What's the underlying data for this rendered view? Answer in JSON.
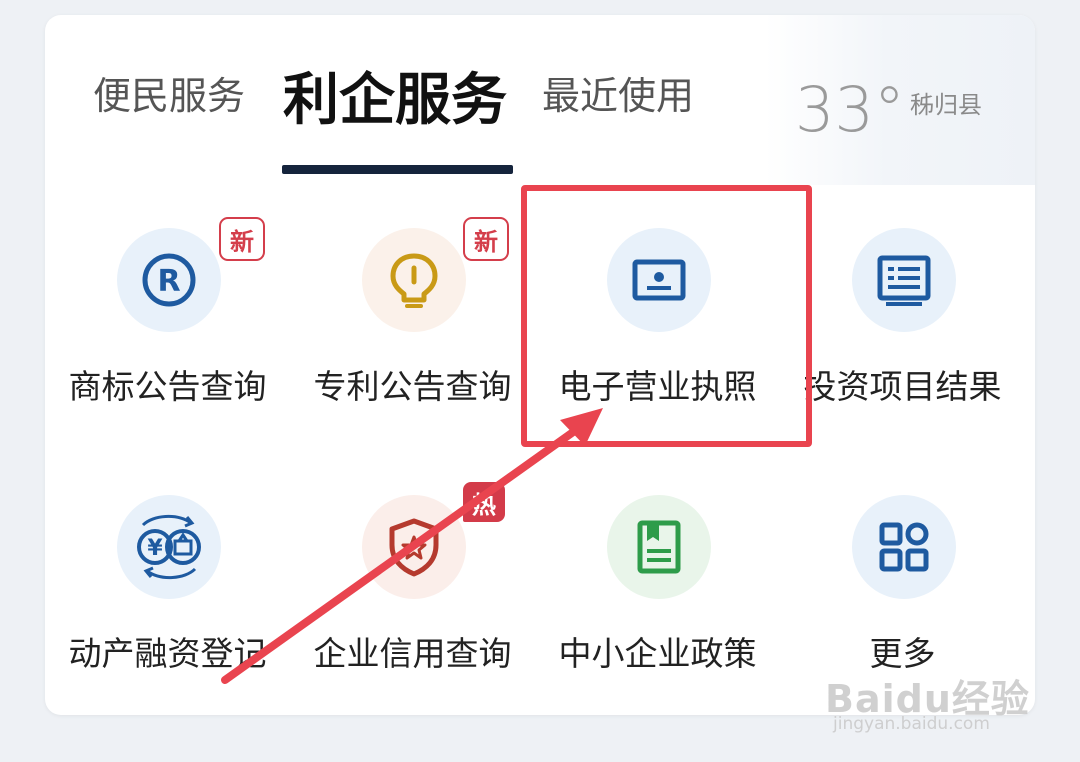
{
  "tabs": [
    {
      "label": "便民服务",
      "active": false
    },
    {
      "label": "利企服务",
      "active": true
    },
    {
      "label": "最近使用",
      "active": false
    }
  ],
  "weather": {
    "temperature": "33°",
    "location": "秭归县"
  },
  "grid": [
    {
      "label": "商标公告查询",
      "icon": "trademark-icon",
      "badge": "新"
    },
    {
      "label": "专利公告查询",
      "icon": "lightbulb-icon",
      "badge": "新"
    },
    {
      "label": "电子营业执照",
      "icon": "id-card-icon",
      "badge": ""
    },
    {
      "label": "投资项目结果",
      "icon": "document-list-icon",
      "badge": ""
    },
    {
      "label": "动产融资登记",
      "icon": "finance-exchange-icon",
      "badge": ""
    },
    {
      "label": "企业信用查询",
      "icon": "shield-icon",
      "badge": "热"
    },
    {
      "label": "中小企业政策",
      "icon": "policy-book-icon",
      "badge": ""
    },
    {
      "label": "更多",
      "icon": "more-grid-icon",
      "badge": ""
    }
  ],
  "watermark": {
    "logo": "Baidu经验",
    "url": "jingyan.baidu.com"
  },
  "colors": {
    "accent_dark": "#15243c",
    "icon_blue": "#1e5aa0",
    "badge_red": "#d43e4b",
    "annotation_red": "#e9444f",
    "icon_gold": "#c99a16",
    "icon_green": "#2e9c4a",
    "icon_brick": "#b53a2e"
  }
}
